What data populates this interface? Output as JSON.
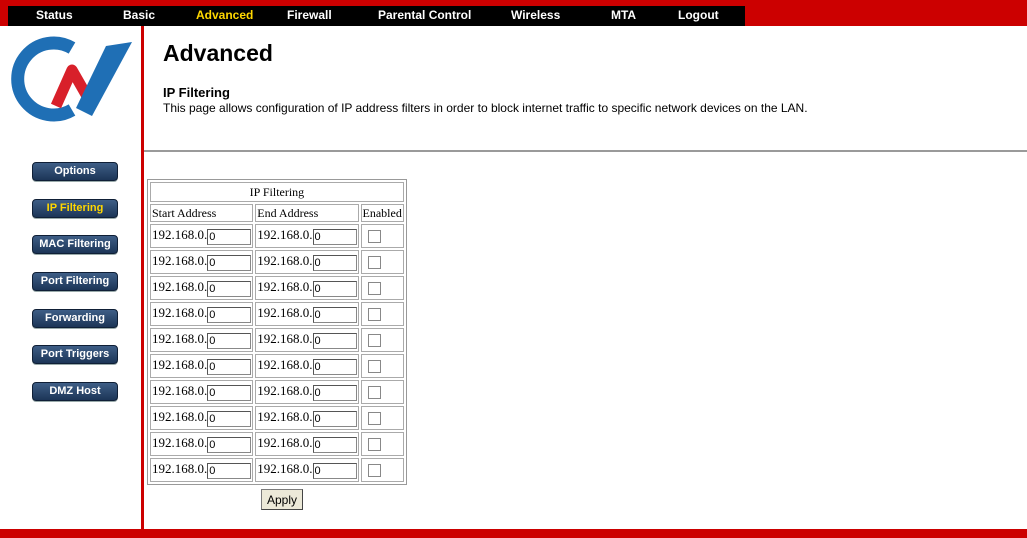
{
  "nav": {
    "items": [
      {
        "label": "Status"
      },
      {
        "label": "Basic"
      },
      {
        "label": "Advanced",
        "active": true
      },
      {
        "label": "Firewall"
      },
      {
        "label": "Parental Control"
      },
      {
        "label": "Wireless"
      },
      {
        "label": "MTA"
      },
      {
        "label": "Logout"
      }
    ]
  },
  "brand": {
    "logo_icon": "cnv-logo-icon",
    "colors": {
      "logo_blue": "#1f6fb5",
      "logo_red": "#d8202a"
    }
  },
  "sidebar": {
    "items": [
      {
        "label": "Options"
      },
      {
        "label": "IP Filtering",
        "active": true
      },
      {
        "label": "MAC Filtering"
      },
      {
        "label": "Port Filtering"
      },
      {
        "label": "Forwarding"
      },
      {
        "label": "Port Triggers"
      },
      {
        "label": "DMZ Host"
      }
    ]
  },
  "page": {
    "title": "Advanced",
    "section_title": "IP Filtering",
    "description": "This page allows configuration of IP address filters in order to block internet traffic to specific network devices on the LAN."
  },
  "table": {
    "title": "IP Filtering",
    "headers": {
      "start": "Start Address",
      "end": "End Address",
      "enabled": "Enabled"
    },
    "rows": [
      {
        "start_prefix": "192.168.0.",
        "start_value": "0",
        "end_prefix": "192.168.0.",
        "end_value": "0",
        "enabled": false
      },
      {
        "start_prefix": "192.168.0.",
        "start_value": "0",
        "end_prefix": "192.168.0.",
        "end_value": "0",
        "enabled": false
      },
      {
        "start_prefix": "192.168.0.",
        "start_value": "0",
        "end_prefix": "192.168.0.",
        "end_value": "0",
        "enabled": false
      },
      {
        "start_prefix": "192.168.0.",
        "start_value": "0",
        "end_prefix": "192.168.0.",
        "end_value": "0",
        "enabled": false
      },
      {
        "start_prefix": "192.168.0.",
        "start_value": "0",
        "end_prefix": "192.168.0.",
        "end_value": "0",
        "enabled": false
      },
      {
        "start_prefix": "192.168.0.",
        "start_value": "0",
        "end_prefix": "192.168.0.",
        "end_value": "0",
        "enabled": false
      },
      {
        "start_prefix": "192.168.0.",
        "start_value": "0",
        "end_prefix": "192.168.0.",
        "end_value": "0",
        "enabled": false
      },
      {
        "start_prefix": "192.168.0.",
        "start_value": "0",
        "end_prefix": "192.168.0.",
        "end_value": "0",
        "enabled": false
      },
      {
        "start_prefix": "192.168.0.",
        "start_value": "0",
        "end_prefix": "192.168.0.",
        "end_value": "0",
        "enabled": false
      },
      {
        "start_prefix": "192.168.0.",
        "start_value": "0",
        "end_prefix": "192.168.0.",
        "end_value": "0",
        "enabled": false
      }
    ],
    "apply_label": "Apply"
  },
  "colors": {
    "accent_red": "#cc0000",
    "nav_black": "#000000",
    "active_yellow": "#ffd700",
    "button_blue": "#1c3557"
  }
}
